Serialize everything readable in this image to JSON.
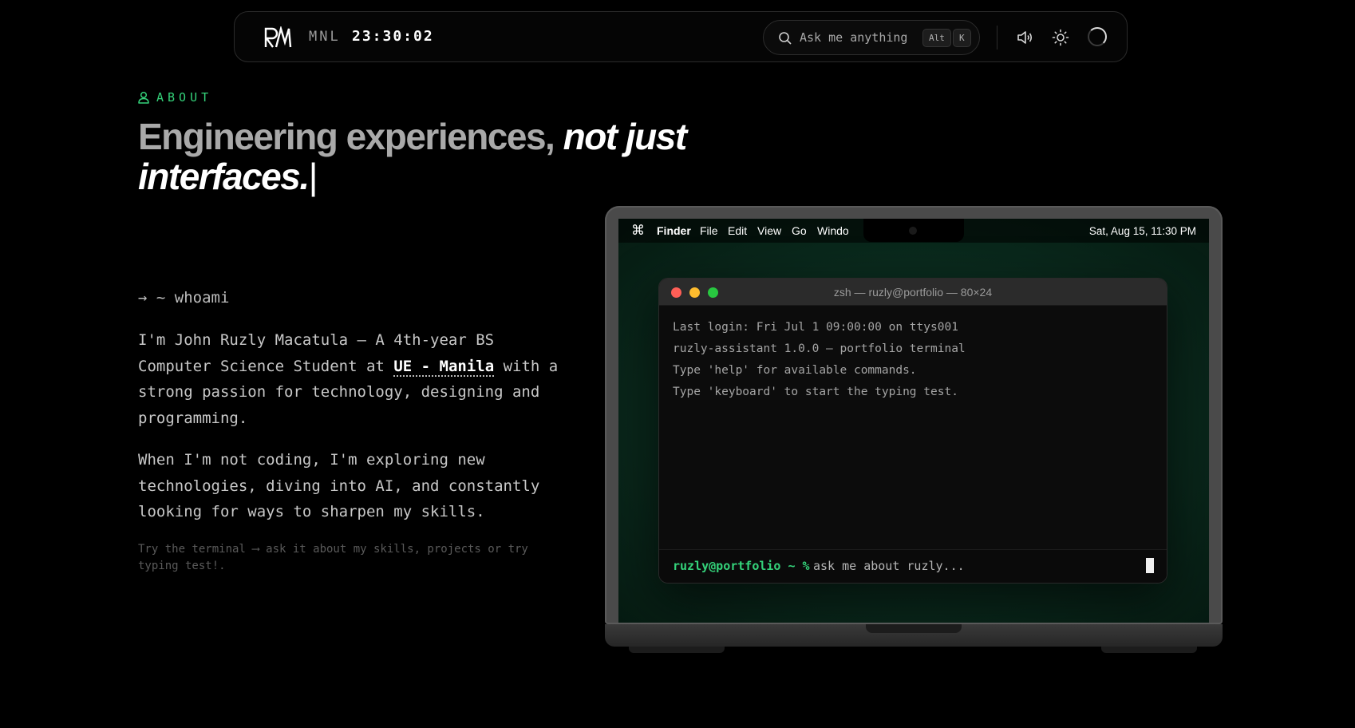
{
  "header": {
    "logo_text": "RM",
    "clock_label": "MNL",
    "clock_time": "23:30:02",
    "search_placeholder": "Ask me anything",
    "shortcut_keys": [
      "Alt",
      "K"
    ],
    "icons": [
      "search-icon",
      "sound-icon",
      "sun-icon",
      "loading-spinner-icon"
    ]
  },
  "about": {
    "tag": "ABOUT",
    "headline_plain": "Engineering experiences,",
    "headline_emphasis": "not just interfaces.",
    "caret": "|",
    "command": "→ ~ whoami",
    "bio_before": "I'm John Ruzly Macatula — A 4th-year BS Computer Science Student at",
    "bio_link": "UE - Manila",
    "bio_after": "with a strong passion for technology, designing and programming.",
    "paragraph2": "When I'm not coding, I'm exploring new technologies, diving into AI, and constantly looking for ways to sharpen my skills.",
    "hint": "Try the terminal ⟶ ask it about my skills, projects or try typing test!."
  },
  "laptop": {
    "menubar": {
      "cmd_symbol": "⌘",
      "app_name": "Finder",
      "items": [
        "File",
        "Edit",
        "View",
        "Go",
        "Windo"
      ],
      "datetime": "Sat, Aug 15, 11:30 PM"
    },
    "terminal": {
      "title": "zsh — ruzly@portfolio — 80×24",
      "lines": [
        "Last login: Fri Jul 1 09:00:00 on ttys001",
        "ruzly-assistant 1.0.0 — portfolio terminal",
        "Type 'help' for available commands.",
        "Type 'keyboard' to start the typing test."
      ],
      "prompt": "ruzly@portfolio ~ %",
      "input_placeholder": "ask me about ruzly..."
    }
  },
  "colors": {
    "accent_green": "#34d27a",
    "background": "#000000",
    "screen_green": "#0a2a1d",
    "traffic_red": "#ff5f57",
    "traffic_yellow": "#febc2e",
    "traffic_green": "#28c840"
  }
}
